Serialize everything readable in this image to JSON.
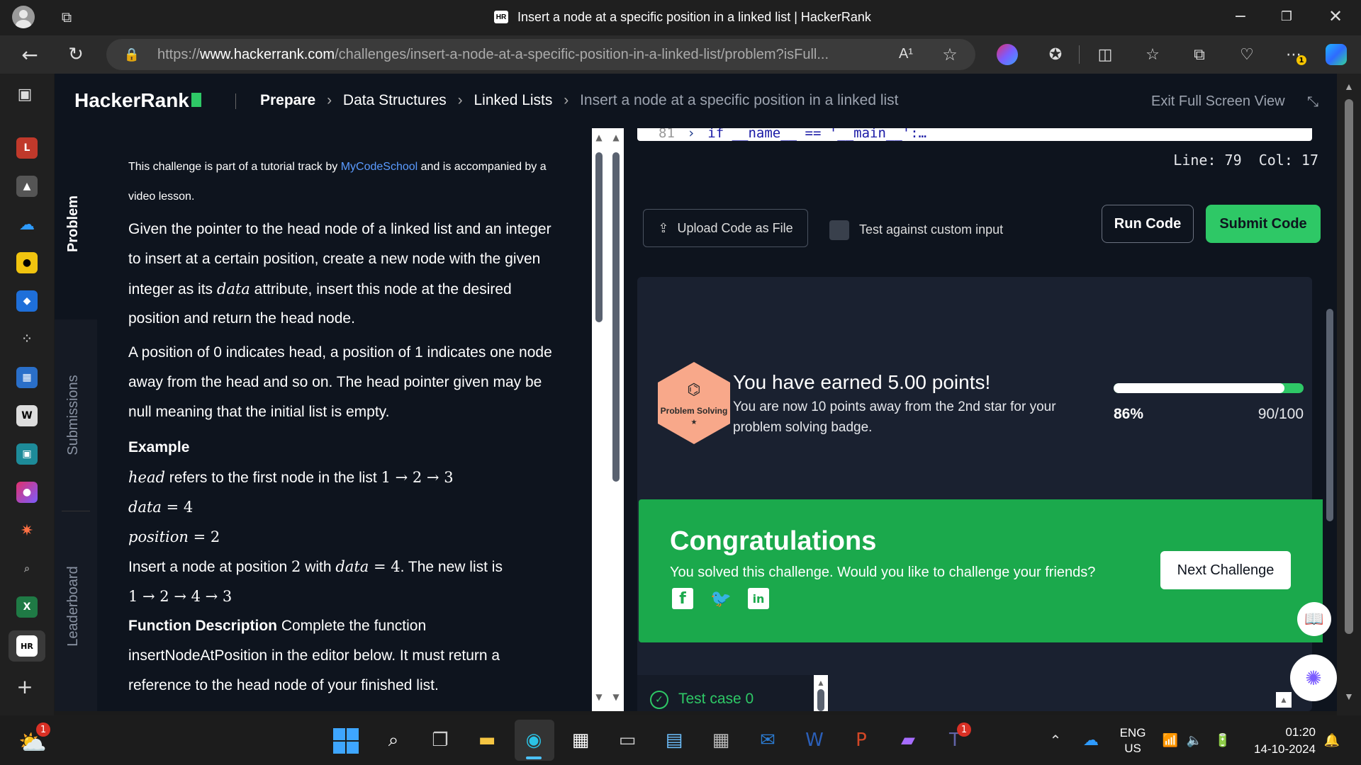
{
  "browser": {
    "tab_title": "Insert a node at a specific position in a linked list | HackerRank",
    "tab_favicon": "HR",
    "url_prefix": "https://",
    "url_domain": "www.hackerrank.com",
    "url_path": "/challenges/insert-a-node-at-a-specific-position-in-a-linked-list/problem?isFull...",
    "read_aloud": "A¹",
    "extension_badge": "1"
  },
  "header": {
    "logo": "HackerRank",
    "breadcrumb": [
      "Prepare",
      "Data Structures",
      "Linked Lists",
      "Insert a node at a specific position in a linked list"
    ],
    "exit_fullscreen": "Exit Full Screen View"
  },
  "side_tabs": {
    "problem": "Problem",
    "submissions": "Submissions",
    "leaderboard": "Leaderboard"
  },
  "problem": {
    "intro_pre": "This challenge is part of a tutorial track by ",
    "intro_link": "MyCodeSchool",
    "intro_post": " and is accompanied by a",
    "intro_line2": "video lesson.",
    "para1": [
      "Given the pointer to the head node of a linked list and an integer",
      "to insert at a certain position, create a new node with the given"
    ],
    "para1_l3_pre": "integer as its ",
    "para1_l3_math": "data",
    "para1_l3_post": " attribute, insert this node at the desired",
    "para1_l4": "position and return the head node.",
    "para2": [
      "A position of 0 indicates head, a position of 1 indicates one node",
      "away from the head and so on. The head pointer given may be",
      "null meaning that the initial list is empty."
    ],
    "example_heading": "Example",
    "ex_head_math": "head",
    "ex_head_text": " refers to the first node in the list ",
    "ex_head_list": "1 → 2 → 3",
    "ex_data": "data",
    "ex_data_val": " = 4",
    "ex_pos": "position",
    "ex_pos_val": " = 2",
    "ex_insert_pre": "Insert a node at position ",
    "ex_insert_2": "2",
    "ex_insert_with": " with ",
    "ex_insert_data": "data",
    "ex_insert_eq": " = 4",
    "ex_insert_post": ". The new list is",
    "ex_new_list": "1 → 2 → 4 → 3",
    "func_heading": "Function Description",
    "func_text": " Complete the function",
    "func_l2": "insertNodeAtPosition in the editor below. It must return a",
    "func_l3": "reference to the head node of your finished list."
  },
  "editor": {
    "code_line_no": "81",
    "code_line": "if __name__ == '__main__':…",
    "cursor_pos": "Line: 79  Col: 17",
    "upload": "Upload Code as File",
    "custom_input": "Test against custom input",
    "run": "Run Code",
    "submit": "Submit Code"
  },
  "result": {
    "badge_label": "Problem Solving",
    "badge_star": "★",
    "earned": "You have earned 5.00 points!",
    "away_line1": "You are now 10 points away from the 2nd star for your",
    "away_line2": "problem solving badge.",
    "progress_pct": "86%",
    "progress_value": 0.9,
    "progress_fraction": "90/100",
    "congrats_title": "Congratulations",
    "congrats_text": "You solved this challenge. Would you like to challenge your friends?",
    "next": "Next Challenge",
    "test_case": "Test case 0"
  },
  "taskbar": {
    "weather_badge": "1",
    "teams_badge": "1",
    "lang1": "ENG",
    "lang2": "US",
    "time": "01:20",
    "date": "14-10-2024"
  },
  "colors": {
    "green": "#1ba94c",
    "bright_green": "#2ec866",
    "link": "#5a9bff",
    "badge": "#f8a88a"
  }
}
